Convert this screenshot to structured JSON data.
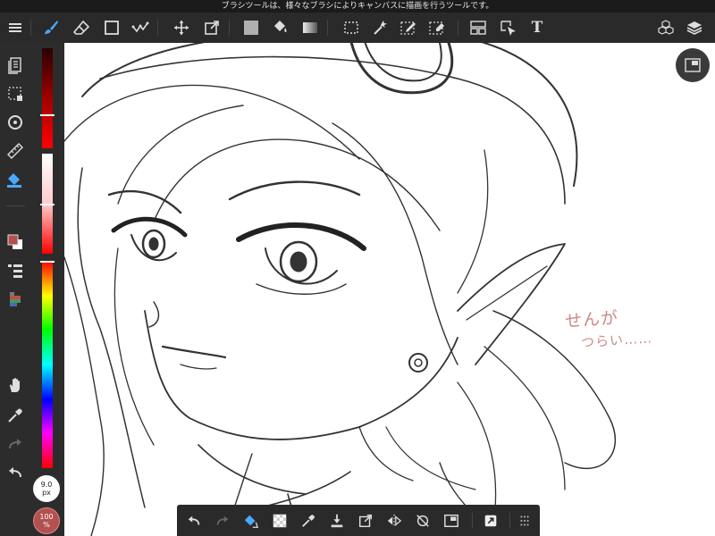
{
  "hint": {
    "text": "ブラシツールは、様々なブラシによりキャンバスに描画を行うツールです。"
  },
  "toolbar": {
    "menu_icon": "hamburger-icon",
    "tools": [
      {
        "name": "brush",
        "icon": "brush-icon",
        "active": true
      },
      {
        "name": "eraser",
        "icon": "eraser-icon"
      },
      {
        "name": "shape",
        "icon": "square-icon"
      },
      {
        "name": "correction",
        "icon": "correction-icon"
      },
      {
        "name": "move",
        "icon": "move-icon"
      },
      {
        "name": "transform",
        "icon": "transform-icon"
      },
      {
        "name": "fill",
        "icon": "fill-color-icon"
      },
      {
        "name": "bucket",
        "icon": "bucket-icon"
      },
      {
        "name": "gradient",
        "icon": "gradient-icon"
      },
      {
        "name": "select",
        "icon": "marquee-icon"
      },
      {
        "name": "magic-wand",
        "icon": "magic-wand-icon"
      },
      {
        "name": "select-pen",
        "icon": "select-pen-icon"
      },
      {
        "name": "select-eraser",
        "icon": "select-eraser-icon"
      },
      {
        "name": "divide",
        "icon": "frame-divide-icon"
      },
      {
        "name": "operation",
        "icon": "operation-icon"
      },
      {
        "name": "text",
        "icon": "text-icon",
        "label": "T"
      }
    ],
    "right": [
      "material-icon",
      "layers-icon"
    ]
  },
  "left_panel": {
    "items": [
      "document-icon",
      "selection-icon",
      "snap-icon",
      "ruler-icon",
      "ink-fill-icon",
      "color-swatch-icon",
      "brush-list-icon",
      "color-palette-icon",
      "hand-icon",
      "eyedropper-icon",
      "redo-icon",
      "undo-icon"
    ]
  },
  "brush": {
    "size_value": "9.0",
    "size_unit": "px",
    "opacity_value": "100",
    "opacity_unit": "%",
    "size_level": 0.45,
    "opacity_level": 1.0
  },
  "colors": {
    "accent": "#4aa8ff",
    "current_color": "#b35050",
    "panel": "#2a2a2a"
  },
  "canvas": {
    "annotation_line1": "せんが",
    "annotation_line2": "つらい……"
  },
  "bottom_bar": {
    "items": [
      "undo-icon",
      "redo-icon",
      "brush-fill-icon",
      "transparent-icon",
      "eyedropper-icon",
      "save-icon",
      "export-icon",
      "flip-icon",
      "rotate-off-icon",
      "fit-icon",
      "share-icon",
      "grid-menu-icon"
    ]
  }
}
